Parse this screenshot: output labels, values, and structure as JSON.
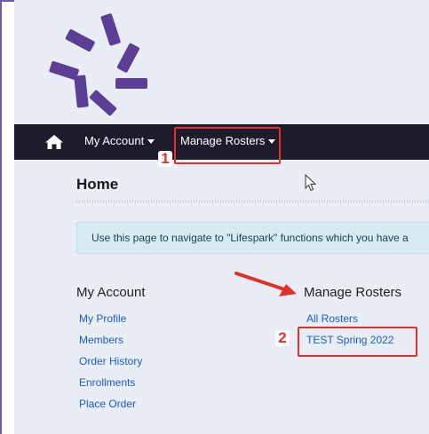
{
  "nav": {
    "my_account": "My Account",
    "manage_rosters": "Manage Rosters"
  },
  "page": {
    "title": "Home",
    "info": "Use this page to navigate to \"Lifespark\" functions which you have a"
  },
  "my_account": {
    "heading": "My Account",
    "links": [
      "My Profile",
      "Members",
      "Order History",
      "Enrollments",
      "Place Order"
    ]
  },
  "manage_rosters": {
    "heading": "Manage Rosters",
    "links": [
      "All Rosters",
      "TEST Spring 2022"
    ]
  },
  "annotations": {
    "step1": "1",
    "step2": "2"
  },
  "colors": {
    "navbar": "#1c1c2b",
    "page_background": "#e9edf5",
    "link": "#1a5cc8",
    "annotation_red": "#e0312e",
    "logo_purple": "#5b3f96",
    "info_background": "#d6ecf2"
  },
  "icons": [
    "home-icon",
    "caret-down-icon",
    "mouse-cursor-icon",
    "lifespark-logo"
  ]
}
